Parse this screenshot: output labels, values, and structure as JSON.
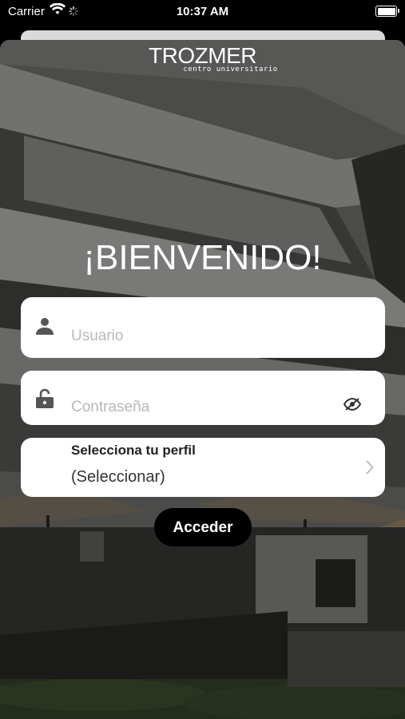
{
  "status_bar": {
    "carrier": "Carrier",
    "time": "10:37 AM",
    "icons": [
      "wifi-icon",
      "activity-spinner-icon",
      "battery-icon"
    ]
  },
  "logo": {
    "brand": "TROZMER",
    "subtitle": "centro universitario"
  },
  "welcome": "¡BIENVENIDO!",
  "form": {
    "username_placeholder": "Usuario",
    "password_placeholder": "Contraseña",
    "profile_label": "Selecciona tu perfil",
    "profile_value": "(Seleccionar)",
    "submit_label": "Acceder"
  },
  "icons": {
    "username": "user-icon",
    "password": "lock-open-icon",
    "password_toggle": "eye-slash-icon",
    "profile": "chevron-right-icon"
  },
  "colors": {
    "button_bg": "#000000",
    "field_bg": "#ffffff",
    "placeholder": "#b8b8b8"
  }
}
